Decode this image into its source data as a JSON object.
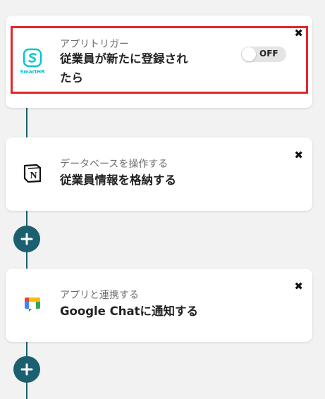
{
  "steps": [
    {
      "category": "アプリトリガー",
      "title": "従業員が新たに登録されたら",
      "app_icon_label": "SmartHR",
      "toggle_label": "OFF",
      "close": "✖"
    },
    {
      "category": "データベースを操作する",
      "title": "従業員情報を格納する",
      "close": "✖"
    },
    {
      "category": "アプリと連携する",
      "title": "Google Chatに通知する",
      "close": "✖"
    }
  ],
  "colors": {
    "connector": "#1b5f70",
    "add_button": "#1b5f70",
    "highlight_border": "#e1262d",
    "smarthr": "#00c4cc"
  },
  "icons": [
    "smarthr-icon",
    "notion-icon",
    "google-chat-icon",
    "plus-icon",
    "close-icon"
  ]
}
